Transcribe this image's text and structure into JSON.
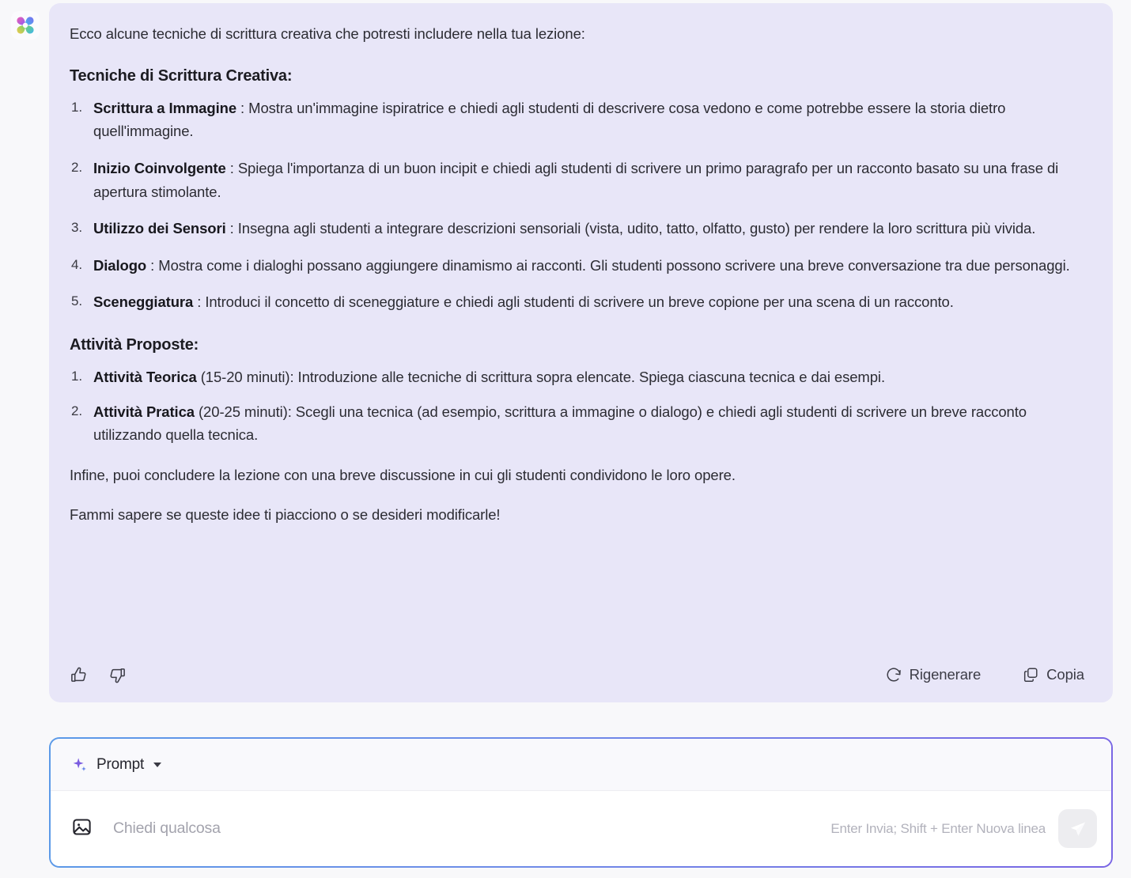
{
  "avatar": {
    "icon": "ai-clover-icon"
  },
  "message": {
    "intro": "Ecco alcune tecniche di scrittura creativa che potresti includere nella tua lezione:",
    "heading_techniques": "Tecniche di Scrittura Creativa:",
    "techniques": [
      {
        "term": "Scrittura a Immagine",
        "sep": " : ",
        "text": "Mostra un'immagine ispiratrice e chiedi agli studenti di descrivere cosa vedono e come potrebbe essere la storia dietro quell'immagine."
      },
      {
        "term": "Inizio Coinvolgente",
        "sep": " : ",
        "text": "Spiega l'importanza di un buon incipit e chiedi agli studenti di scrivere un primo paragrafo per un racconto basato su una frase di apertura stimolante."
      },
      {
        "term": "Utilizzo dei Sensori",
        "sep": " : ",
        "text": "Insegna agli studenti a integrare descrizioni sensoriali (vista, udito, tatto, olfatto, gusto) per rendere la loro scrittura più vivida."
      },
      {
        "term": "Dialogo",
        "sep": " : ",
        "text": "Mostra come i dialoghi possano aggiungere dinamismo ai racconti. Gli studenti possono scrivere una breve conversazione tra due personaggi."
      },
      {
        "term": "Sceneggiatura",
        "sep": " : ",
        "text": "Introduci il concetto di sceneggiature e chiedi agli studenti di scrivere un breve copione per una scena di un racconto."
      }
    ],
    "heading_activities": "Attività Proposte:",
    "activities": [
      {
        "term": "Attività Teorica",
        "sep": " ",
        "text": "(15-20 minuti): Introduzione alle tecniche di scrittura sopra elencate. Spiega ciascuna tecnica e dai esempi."
      },
      {
        "term": "Attività Pratica",
        "sep": " ",
        "text": "(20-25 minuti): Scegli una tecnica (ad esempio, scrittura a immagine o dialogo) e chiedi agli studenti di scrivere un breve racconto utilizzando quella tecnica."
      }
    ],
    "closing_paragraph": "Infine, puoi concludere la lezione con una breve discussione in cui gli studenti condividono le loro opere.",
    "followup_paragraph": "Fammi sapere se queste idee ti piacciono o se desideri modificarle!"
  },
  "actions": {
    "thumbs_up_icon": "thumbs-up-icon",
    "thumbs_down_icon": "thumbs-down-icon",
    "regenerate_label": "Rigenerare",
    "regenerate_icon": "refresh-icon",
    "copy_label": "Copia",
    "copy_icon": "copy-icon"
  },
  "composer": {
    "prompt_label": "Prompt",
    "prompt_icon": "sparkle-icon",
    "dropdown_icon": "chevron-down-icon",
    "image_icon": "image-icon",
    "input_value": "",
    "input_placeholder": "Chiedi qualcosa",
    "hint": "Enter Invia; Shift + Enter Nuova linea",
    "send_icon": "send-icon"
  },
  "colors": {
    "bubble_bg": "#e8e6f8",
    "page_bg": "#f8f8fa",
    "border_start": "#5b9ae8",
    "border_end": "#7a66e4",
    "sparkle": "#7b5ce0",
    "text": "#2c2c33"
  }
}
